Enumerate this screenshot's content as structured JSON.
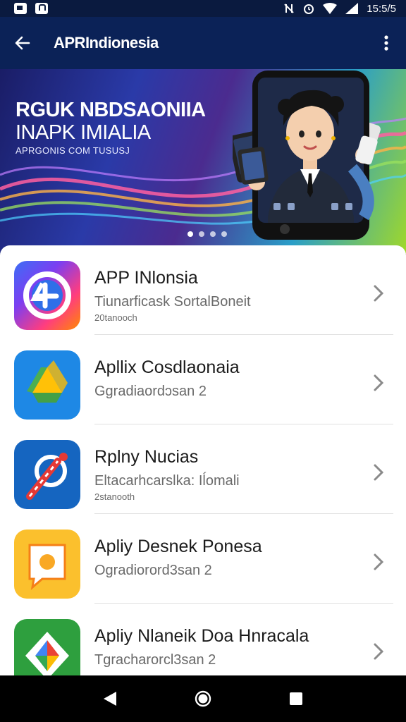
{
  "status_bar": {
    "time": "15:5/5"
  },
  "app_bar": {
    "title": "APRIndionesia"
  },
  "banner": {
    "headline_1": "RGUK NBDSAONIIA",
    "headline_2": "INAPK IMIALIA",
    "subtitle": "APRGONIS COM TUSUSJ",
    "dot_count": 4,
    "active_dot": 0
  },
  "apps": [
    {
      "title": "APP INlonsia",
      "subtitle": "Tiunarficask SortalBoneit",
      "meta": "20tanooch",
      "icon": "compass-plus-icon"
    },
    {
      "title": "Apllix Cosdlaonaia",
      "subtitle": "Ggradiaordɔsan 2",
      "meta": "",
      "icon": "drive-triangle-icon"
    },
    {
      "title": "Rplny Nucias",
      "subtitle": "Eltacarhcarslka: Iĺomali",
      "meta": "2stanooth",
      "icon": "robot-tool-icon"
    },
    {
      "title": "Apliy Desnek Ponesa",
      "subtitle": "Ogradiorord3san 2",
      "meta": "",
      "icon": "photo-chat-icon"
    },
    {
      "title": "Apliy Nlaneik Doa Hnracala",
      "subtitle": "Tgracharorcl3san 2",
      "meta": "",
      "icon": "google-diamond-icon"
    }
  ]
}
